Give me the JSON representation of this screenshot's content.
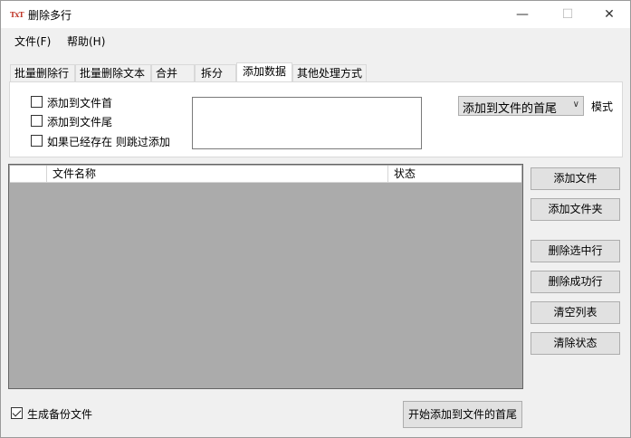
{
  "window": {
    "icon_text": "TxT",
    "title": "删除多行"
  },
  "menu": {
    "items": [
      "文件(F)",
      "帮助(H)"
    ]
  },
  "tabs": [
    {
      "label": "批量删除行",
      "active": false
    },
    {
      "label": "批量删除文本",
      "active": false
    },
    {
      "label": "合并",
      "active": false
    },
    {
      "label": "拆分",
      "active": false
    },
    {
      "label": "添加数据",
      "active": true
    },
    {
      "label": "其他处理方式",
      "active": false
    }
  ],
  "options": {
    "add_to_head": {
      "label": "添加到文件首",
      "checked": false
    },
    "add_to_tail": {
      "label": "添加到文件尾",
      "checked": false
    },
    "skip_if_exists": {
      "label": "如果已经存在 则跳过添加",
      "checked": false
    },
    "text_value": "",
    "mode_select": {
      "value": "添加到文件的首尾"
    },
    "mode_label": "模式"
  },
  "file_table": {
    "columns": [
      "",
      "文件名称",
      "状态"
    ],
    "rows": []
  },
  "side_buttons": {
    "add_file": "添加文件",
    "add_folder": "添加文件夹",
    "delete_selected": "删除选中行",
    "delete_success": "删除成功行",
    "clear_list": "清空列表",
    "clear_status": "清除状态"
  },
  "footer": {
    "backup": {
      "label": "生成备份文件",
      "checked": true
    },
    "start_button": "开始添加到文件的首尾"
  }
}
